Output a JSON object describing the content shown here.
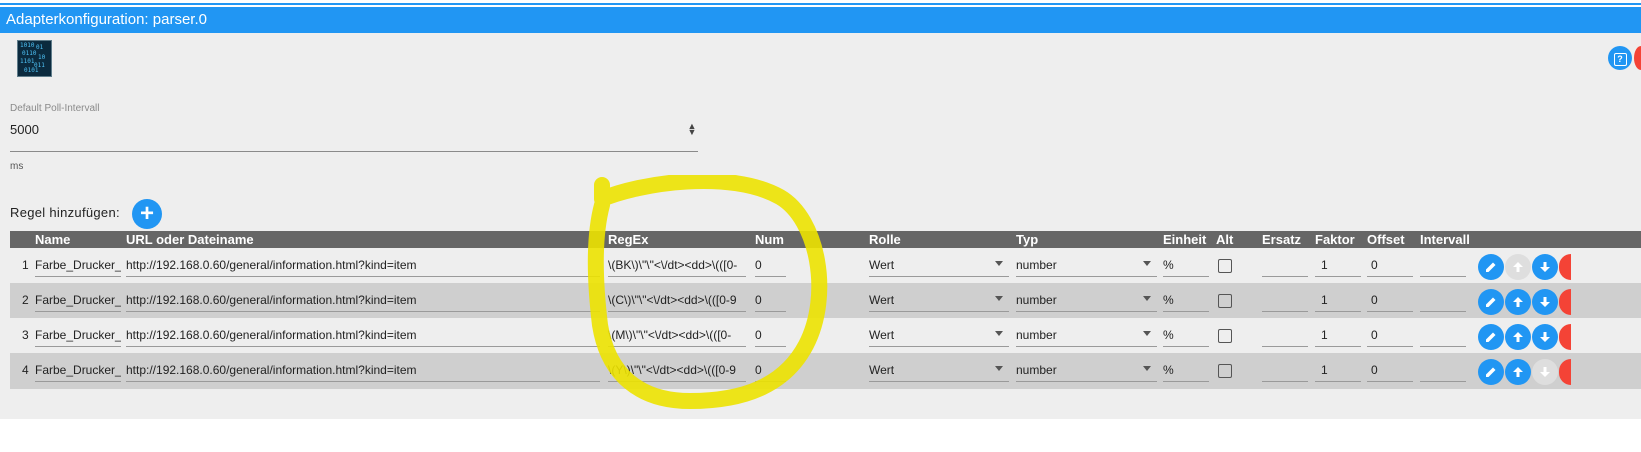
{
  "window": {
    "title": "Adapterkonfiguration: parser.0"
  },
  "colors": {
    "accent": "#2196f3",
    "danger": "#f44336",
    "header_bg": "#666666",
    "highlight_marker": "#ece200"
  },
  "icons": {
    "adapter_logo": "parser-binary-logo-icon",
    "help": "help-icon",
    "add": "plus-icon",
    "edit": "pencil-icon",
    "up": "arrow-up-icon",
    "down": "arrow-down-icon",
    "delete": "delete-icon"
  },
  "poll": {
    "label": "Default Poll-Intervall",
    "value": "5000",
    "unit": "ms"
  },
  "add_rule": {
    "label": "Regel hinzufügen:",
    "button": "+"
  },
  "table": {
    "headers": [
      "Name",
      "URL oder Dateiname",
      "RegEx",
      "Num",
      "Rolle",
      "Typ",
      "Einheit",
      "Alt",
      "Ersatz",
      "Faktor",
      "Offset",
      "Intervall"
    ],
    "rows": [
      {
        "num": "1",
        "name": "Farbe_Drucker_I",
        "url": "http://192.168.0.60/general/information.html?kind=item",
        "regex": "\\(BK\\)\\\"\\\"<\\/dt><dd>\\(([0-",
        "numval": "0",
        "role": "Wert",
        "type": "number",
        "unit": "%",
        "alt": false,
        "ersatz": "",
        "faktor": "1",
        "offset": "0",
        "intervall": "",
        "up_enabled": false,
        "down_enabled": true
      },
      {
        "num": "2",
        "name": "Farbe_Drucker_C",
        "url": "http://192.168.0.60/general/information.html?kind=item",
        "regex": "\\(C\\)\\\"\\\"<\\/dt><dd>\\(([0-9",
        "numval": "0",
        "role": "Wert",
        "type": "number",
        "unit": "%",
        "alt": false,
        "ersatz": "",
        "faktor": "1",
        "offset": "0",
        "intervall": "",
        "up_enabled": true,
        "down_enabled": true
      },
      {
        "num": "3",
        "name": "Farbe_Drucker_I",
        "url": "http://192.168.0.60/general/information.html?kind=item",
        "regex": "\\(M\\)\\\"\\\"<\\/dt><dd>\\(([0-",
        "numval": "0",
        "role": "Wert",
        "type": "number",
        "unit": "%",
        "alt": false,
        "ersatz": "",
        "faktor": "1",
        "offset": "0",
        "intervall": "",
        "up_enabled": true,
        "down_enabled": true
      },
      {
        "num": "4",
        "name": "Farbe_Drucker_Y",
        "url": "http://192.168.0.60/general/information.html?kind=item",
        "regex": "\\(Y\\)\\\"\\\"<\\/dt><dd>\\(([0-9",
        "numval": "0",
        "role": "Wert",
        "type": "number",
        "unit": "%",
        "alt": false,
        "ersatz": "",
        "faktor": "1",
        "offset": "0",
        "intervall": "",
        "up_enabled": true,
        "down_enabled": false
      }
    ]
  }
}
